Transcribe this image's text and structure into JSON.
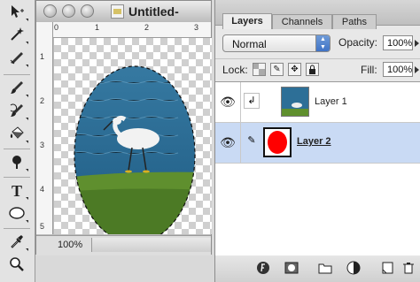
{
  "document": {
    "title": "Untitled-",
    "zoom": "100%",
    "ruler_h_labels": [
      "0",
      "1",
      "2",
      "3"
    ],
    "ruler_v_labels": [
      "1",
      "2",
      "3",
      "4",
      "5"
    ]
  },
  "tools": [
    {
      "name": "move-tool",
      "icon": "move-arrow"
    },
    {
      "name": "magic-wand-tool",
      "icon": "magic-wand"
    },
    {
      "name": "slice-tool",
      "icon": "slice-knife"
    },
    {
      "name": "brush-tool",
      "icon": "brush"
    },
    {
      "name": "history-brush-tool",
      "icon": "history-brush"
    },
    {
      "name": "paint-bucket-tool",
      "icon": "paint-bucket"
    },
    {
      "name": "burn-tool",
      "icon": "burn"
    },
    {
      "name": "type-tool",
      "icon": "T"
    },
    {
      "name": "ellipse-tool",
      "icon": "ellipse"
    },
    {
      "name": "eyedropper-tool",
      "icon": "eyedropper"
    },
    {
      "name": "zoom-tool",
      "icon": "magnifier"
    }
  ],
  "panel": {
    "tabs": [
      "Layers",
      "Channels",
      "Paths"
    ],
    "active_tab": "Layers",
    "blend_mode": "Normal",
    "opacity_label": "Opacity:",
    "opacity_value": "100%",
    "lock_label": "Lock:",
    "fill_label": "Fill:",
    "fill_value": "100%",
    "layers": [
      {
        "name": "Layer 1",
        "visible": true,
        "clipped": true,
        "selected": false
      },
      {
        "name": "Layer 2",
        "visible": true,
        "clipped": false,
        "selected": true
      }
    ]
  },
  "colors": {
    "selection_highlight": "#c9daf4",
    "mask_red": "#ff0000",
    "water_blue": "#2d6f97",
    "grass_green": "#5f8f2e"
  }
}
